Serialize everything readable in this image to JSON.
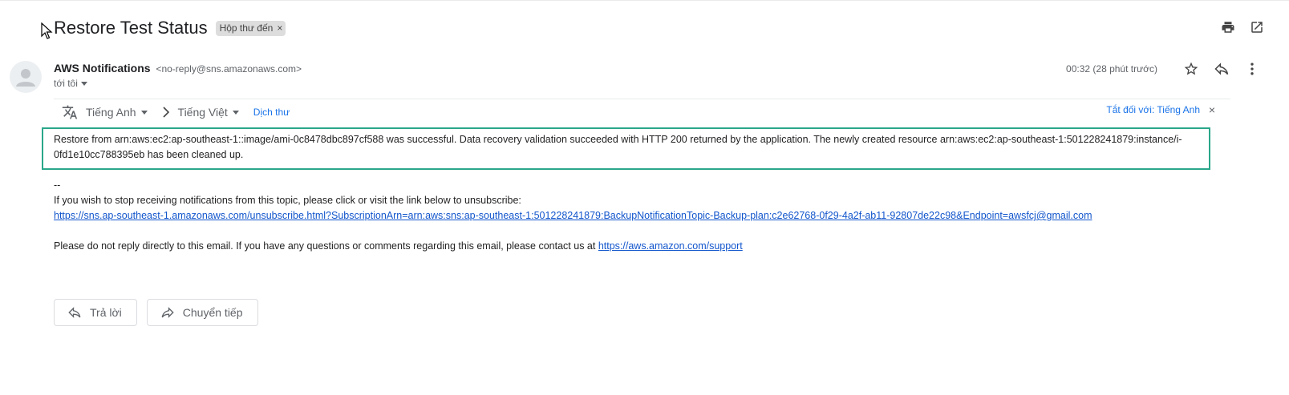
{
  "subject": "Restore Test Status",
  "label_chip": {
    "text": "Hộp thư đến",
    "close": "×"
  },
  "top_icons": [
    "print-icon",
    "open-in-new-window-icon"
  ],
  "sender": {
    "name": "AWS Notifications",
    "email": "<no-reply@sns.amazonaws.com>",
    "to": "tới tôi"
  },
  "meta": {
    "time": "00:32 (28 phút trước)",
    "icons": [
      "star-icon",
      "reply-icon",
      "more-vert-icon"
    ]
  },
  "translate_bar": {
    "source_lang": "Tiếng Anh",
    "target_lang": "Tiếng Việt",
    "translate_link": "Dịch thư",
    "turn_off": "Tắt đối với: Tiếng Anh",
    "close": "×"
  },
  "body": {
    "highlight": "Restore from arn:aws:ec2:ap-southeast-1::image/ami-0c8478dbc897cf588 was successful. Data recovery validation succeeded with HTTP 200 returned by the application. The newly created resource arn:aws:ec2:ap-southeast-1:501228241879:instance/i-0fd1e10cc788395eb has been cleaned up.",
    "separator": "--",
    "unsubscribe_text": "If you wish to stop receiving notifications from this topic, please click or visit the link below to unsubscribe:",
    "unsubscribe_link": "https://sns.ap-southeast-1.amazonaws.com/unsubscribe.html?SubscriptionArn=arn:aws:sns:ap-southeast-1:501228241879:BackupNotificationTopic-Backup-plan:c2e62768-0f29-4a2f-ab11-92807de22c98&Endpoint=awsfcj@gmail.com",
    "contact_text": "Please do not reply directly to this email. If you have any questions or comments regarding this email, please contact us at ",
    "contact_link": "https://aws.amazon.com/support"
  },
  "actions": {
    "reply": "Trả lời",
    "forward": "Chuyển tiếp"
  },
  "colors": {
    "highlight_border": "#2aa78a",
    "link": "#1155cc",
    "accent": "#1a73e8"
  }
}
